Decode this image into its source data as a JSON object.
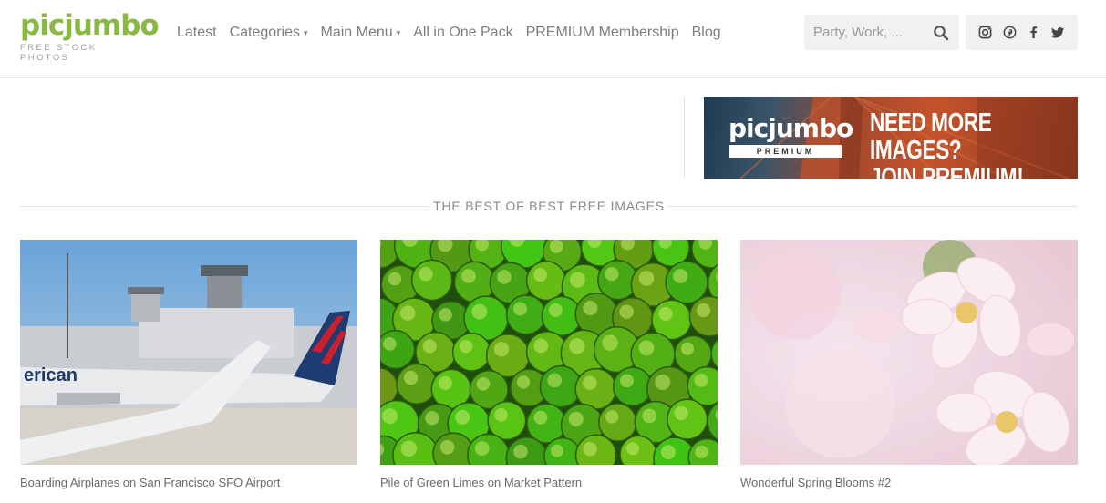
{
  "brand": {
    "logo_main": "picjumbo",
    "logo_sub": "FREE STOCK PHOTOS",
    "accent": "#8ab941"
  },
  "nav": {
    "items": [
      {
        "label": "Latest",
        "dropdown": false
      },
      {
        "label": "Categories",
        "dropdown": true
      },
      {
        "label": "Main Menu",
        "dropdown": true
      },
      {
        "label": "All in One Pack",
        "dropdown": false
      },
      {
        "label": "PREMIUM Membership",
        "dropdown": false
      },
      {
        "label": "Blog",
        "dropdown": false
      }
    ],
    "caret": "▾"
  },
  "search": {
    "placeholder": "Party, Work, ...",
    "value": "",
    "icon": "search-icon"
  },
  "social": [
    "instagram-icon",
    "pinterest-icon",
    "facebook-icon",
    "twitter-icon"
  ],
  "banner": {
    "logo": "picjumbo",
    "tag": "PREMIUM",
    "cta_line1": "NEED MORE IMAGES?",
    "cta_line2": "JOIN PREMIUM!"
  },
  "section": {
    "title": "THE BEST OF BEST FREE IMAGES"
  },
  "cards": [
    {
      "caption": "Boarding Airplanes on San Francisco SFO Airport",
      "image": "airport-photo"
    },
    {
      "caption": "Pile of Green Limes on Market Pattern",
      "image": "limes-photo"
    },
    {
      "caption": "Wonderful Spring Blooms #2",
      "image": "blossom-photo"
    }
  ]
}
